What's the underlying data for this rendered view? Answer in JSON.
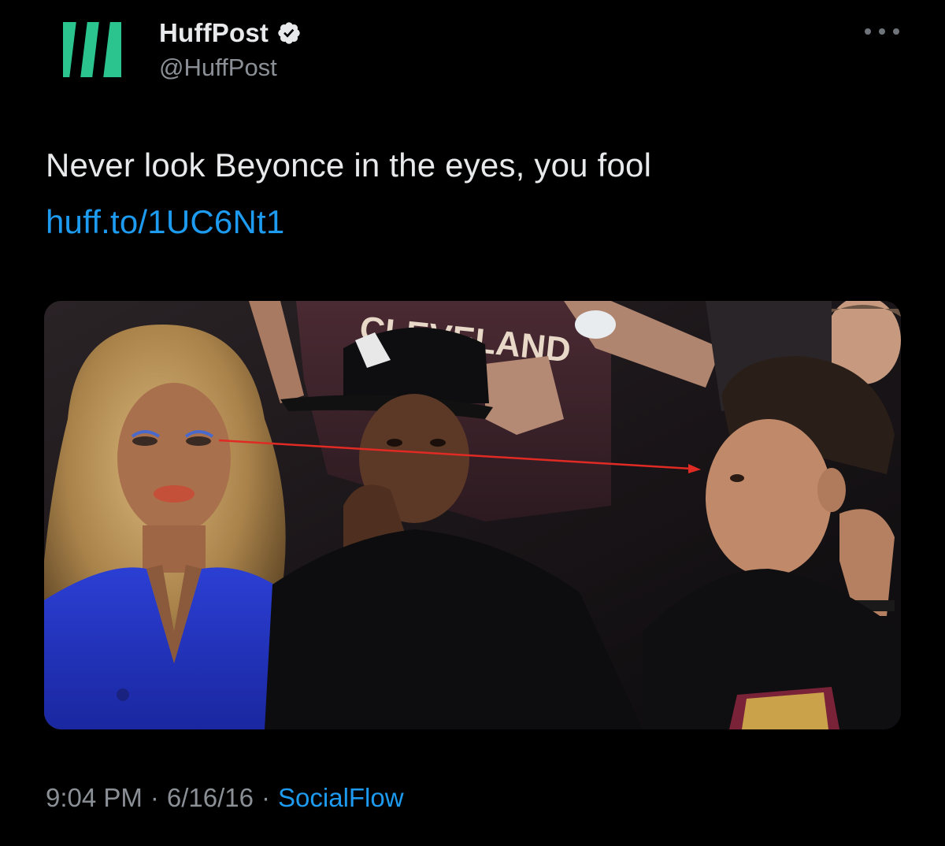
{
  "tweet": {
    "author": {
      "display_name": "HuffPost",
      "handle": "@HuffPost",
      "verified": true,
      "avatar_icon": "huffpost-logo-icon",
      "brand_color": "#2bc48f"
    },
    "more_icon": "ellipsis-icon",
    "text": "Never look Beyonce in the eyes, you fool",
    "link": "huff.to/1UC6Nt1",
    "media": {
      "type": "photo",
      "jersey_text": "CLEVELAND"
    },
    "timestamp": "9:04 PM",
    "date": "6/16/16",
    "separator": "·",
    "source": "SocialFlow"
  },
  "colors": {
    "background": "#000000",
    "text_primary": "#e7e9ea",
    "text_secondary": "#8b9096",
    "link": "#1d9bf0",
    "annotation_arrow": "#e02a24"
  }
}
